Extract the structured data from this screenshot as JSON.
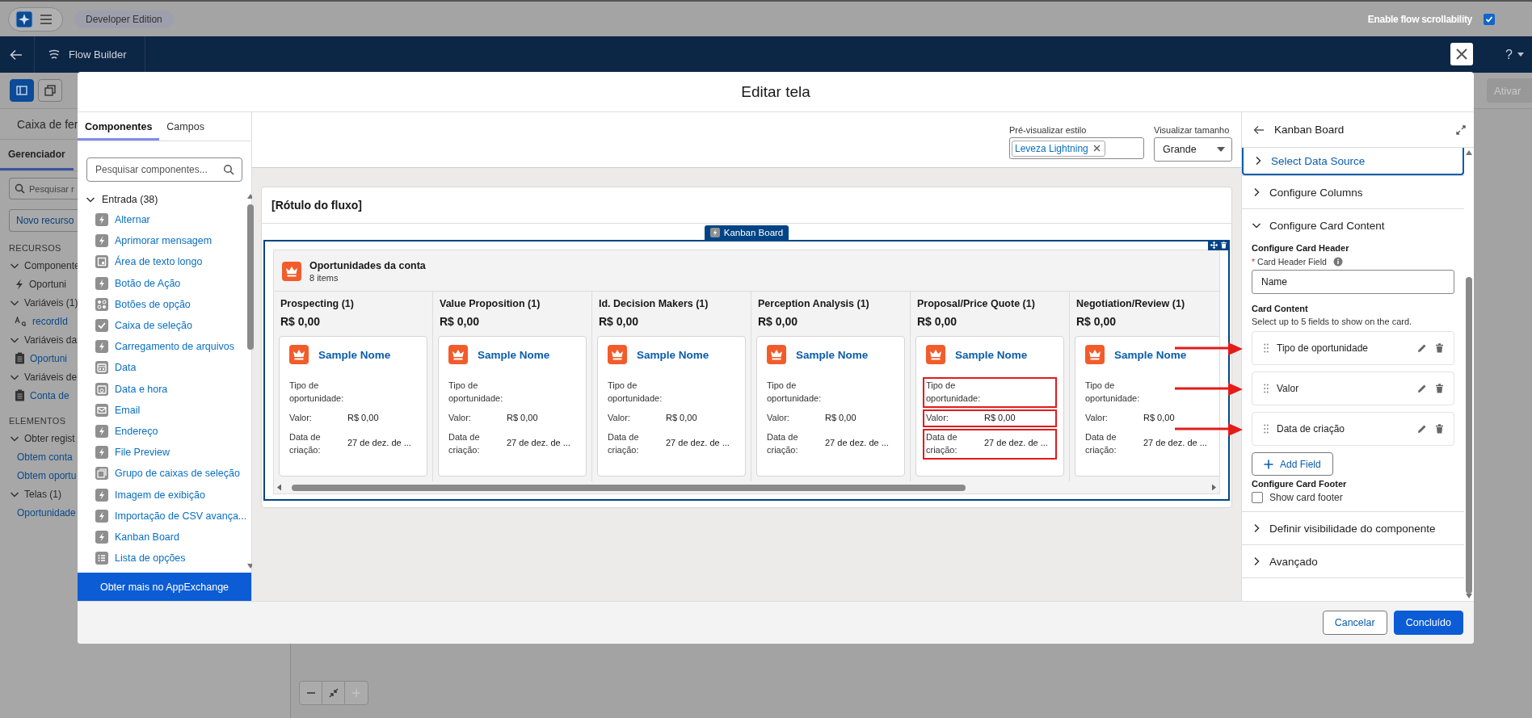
{
  "top_bar": {
    "edition": "Developer Edition",
    "scroll_toggle": {
      "label": "Enable flow scrollability",
      "checked": true
    }
  },
  "nav_bar": {
    "title": "Flow Builder",
    "help": "?"
  },
  "toolbar": {
    "buttons": [
      {
        "kind": "panel",
        "selected": true
      },
      {
        "kind": "copy",
        "selected": false
      }
    ],
    "activate": {
      "label": "Ativar",
      "disabled": true
    }
  },
  "sidebar": {
    "title": "Caixa de fer",
    "tabs": [
      {
        "label": "Gerenciador",
        "selected": true
      }
    ],
    "search": {
      "placeholder": "Pesquisar r"
    },
    "new_button": "Novo recurso",
    "sections": [
      {
        "heading": "RECURSOS",
        "groups": [
          {
            "label": "Componente",
            "expanded": true,
            "children": [
              {
                "kind": "bolt",
                "label": "Oportuni"
              }
            ]
          },
          {
            "label": "Variáveis (1)",
            "expanded": true,
            "children": [
              {
                "kind": "text",
                "label": "recordId"
              }
            ]
          },
          {
            "label": "Variáveis da",
            "expanded": true,
            "children": [
              {
                "kind": "record",
                "label": "Oportuni"
              }
            ]
          },
          {
            "label": "Variáveis de",
            "expanded": true,
            "children": [
              {
                "kind": "record",
                "label": "Conta de"
              }
            ]
          }
        ]
      },
      {
        "heading": "ELEMENTOS",
        "groups": [
          {
            "label": "Obter regist",
            "expanded": true,
            "children": [
              {
                "kind": "plain",
                "label": "Obtem conta"
              },
              {
                "kind": "plain",
                "label": "Obtem oportu"
              }
            ]
          },
          {
            "label": "Telas (1)",
            "expanded": true,
            "children": [
              {
                "kind": "plain",
                "label": "Oportunidade"
              }
            ]
          }
        ]
      }
    ]
  },
  "zoom_controls": {
    "zoom_in_disabled": true
  },
  "modal": {
    "title": "Editar tela",
    "component_panel": {
      "tabs": [
        {
          "label": "Componentes",
          "selected": true
        },
        {
          "label": "Campos",
          "selected": false
        }
      ],
      "search": {
        "placeholder": "Pesquisar componentes..."
      },
      "group": {
        "label": "Entrada (38)",
        "expanded": true,
        "children": [
          {
            "label": "Alternar",
            "kind": "bolt"
          },
          {
            "label": "Aprimorar mensagem",
            "kind": "bolt"
          },
          {
            "label": "Área de texto longo",
            "kind": "textarea"
          },
          {
            "label": "Botão de Ação",
            "kind": "bolt"
          },
          {
            "label": "Botões de opção",
            "kind": "radio"
          },
          {
            "label": "Caixa de seleção",
            "kind": "checkbox"
          },
          {
            "label": "Carregamento de arquivos",
            "kind": "bolt"
          },
          {
            "label": "Data",
            "kind": "calendar"
          },
          {
            "label": "Data e hora",
            "kind": "datetime"
          },
          {
            "label": "Email",
            "kind": "email"
          },
          {
            "label": "Endereço",
            "kind": "bolt"
          },
          {
            "label": "File Preview",
            "kind": "bolt"
          },
          {
            "label": "Grupo de caixas de seleção",
            "kind": "checkgroup"
          },
          {
            "label": "Imagem de exibição",
            "kind": "bolt"
          },
          {
            "label": "Importação de CSV avança...",
            "kind": "bolt"
          },
          {
            "label": "Kanban Board",
            "kind": "bolt"
          },
          {
            "label": "Lista de opções",
            "kind": "list"
          }
        ]
      },
      "footer_button": "Obter mais no AppExchange"
    },
    "preview": {
      "style_label": "Pré-visualizar estilo",
      "style_value": "Leveza Lightning",
      "size_label": "Visualizar tamanho",
      "size_value": "Grande"
    },
    "screen": {
      "label": "[Rótulo do fluxo]",
      "component_badge": "Kanban Board",
      "component_selected": true,
      "board": {
        "title": "Oportunidades da conta",
        "count": "8 items",
        "columns": [
          {
            "title": "Prospecting (1)",
            "total": "R$ 0,00",
            "cards": [
              {
                "name": "Sample Nome",
                "fields": [
                  {
                    "label": "Tipo de oportunidade:",
                    "highlighted": false
                  },
                  {
                    "label": "Valor:",
                    "value": "R$ 0,00",
                    "highlighted": false
                  },
                  {
                    "label": "Data de criação:",
                    "value": "27 de dez. de ...",
                    "highlighted": false
                  }
                ]
              }
            ]
          },
          {
            "title": "Value Proposition (1)",
            "total": "R$ 0,00",
            "cards": [
              {
                "name": "Sample Nome",
                "fields": [
                  {
                    "label": "Tipo de oportunidade:",
                    "highlighted": false
                  },
                  {
                    "label": "Valor:",
                    "value": "R$ 0,00",
                    "highlighted": false
                  },
                  {
                    "label": "Data de criação:",
                    "value": "27 de dez. de ...",
                    "highlighted": false
                  }
                ]
              }
            ]
          },
          {
            "title": "Id. Decision Makers (1)",
            "total": "R$ 0,00",
            "cards": [
              {
                "name": "Sample Nome",
                "fields": [
                  {
                    "label": "Tipo de oportunidade:",
                    "highlighted": false
                  },
                  {
                    "label": "Valor:",
                    "value": "R$ 0,00",
                    "highlighted": false
                  },
                  {
                    "label": "Data de criação:",
                    "value": "27 de dez. de ...",
                    "highlighted": false
                  }
                ]
              }
            ]
          },
          {
            "title": "Perception Analysis (1)",
            "total": "R$ 0,00",
            "cards": [
              {
                "name": "Sample Nome",
                "fields": [
                  {
                    "label": "Tipo de oportunidade:",
                    "highlighted": false
                  },
                  {
                    "label": "Valor:",
                    "value": "R$ 0,00",
                    "highlighted": false
                  },
                  {
                    "label": "Data de criação:",
                    "value": "27 de dez. de ...",
                    "highlighted": false
                  }
                ]
              }
            ]
          },
          {
            "title": "Proposal/Price Quote (1)",
            "total": "R$ 0,00",
            "cards": [
              {
                "name": "Sample Nome",
                "fields": [
                  {
                    "label": "Tipo de oportunidade:",
                    "highlighted": true
                  },
                  {
                    "label": "Valor:",
                    "value": "R$ 0,00",
                    "highlighted": true
                  },
                  {
                    "label": "Data de criação:",
                    "value": "27 de dez. de ...",
                    "highlighted": true
                  }
                ]
              }
            ]
          },
          {
            "title": "Negotiation/Review (1)",
            "total": "R$ 0,00",
            "cards": [
              {
                "name": "Sample Nome",
                "fields": [
                  {
                    "label": "Tipo de oportunidade:",
                    "highlighted": false
                  },
                  {
                    "label": "Valor:",
                    "value": "R$ 0,00",
                    "highlighted": false
                  },
                  {
                    "label": "Data de criação:",
                    "value": "27 de dez. de ...",
                    "highlighted": false
                  }
                ]
              }
            ]
          }
        ]
      }
    },
    "properties_panel": {
      "title": "Kanban Board",
      "sections": [
        {
          "label": "Select Data Source",
          "expanded": false,
          "focused": true
        },
        {
          "label": "Configure Columns",
          "expanded": false,
          "focused": false
        },
        {
          "label": "Configure Card Content",
          "expanded": true,
          "focused": false,
          "content": {
            "header_heading": "Configure Card Header",
            "field_label": "Card Header Field",
            "required_mark": "*",
            "field_value": "Name",
            "content_heading": "Card Content",
            "content_help": "Select up to 5 fields to show on the card.",
            "fields": [
              {
                "label": "Tipo de oportunidade",
                "marked": true
              },
              {
                "label": "Valor",
                "marked": true
              },
              {
                "label": "Data de criação",
                "marked": true
              }
            ],
            "add_button": "Add Field",
            "footer_heading": "Configure Card Footer",
            "footer_checkbox": {
              "label": "Show card footer",
              "checked": false
            }
          }
        },
        {
          "label": "Definir visibilidade do componente",
          "expanded": false,
          "focused": false
        },
        {
          "label": "Avançado",
          "expanded": false,
          "focused": false
        }
      ]
    },
    "footer_buttons": [
      {
        "label": "Cancelar",
        "kind": "neutral"
      },
      {
        "label": "Concluído",
        "kind": "brand"
      }
    ]
  }
}
